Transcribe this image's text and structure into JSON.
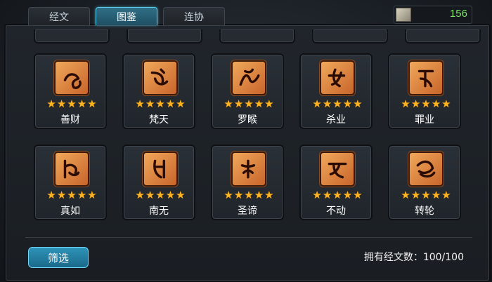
{
  "tabs": [
    {
      "label": "经文",
      "active": false
    },
    {
      "label": "图鉴",
      "active": true
    },
    {
      "label": "连协",
      "active": false
    }
  ],
  "currency": {
    "icon": "scroll-icon",
    "value": "156"
  },
  "cards": [
    {
      "name": "善财",
      "stars": 5,
      "glyph": "sanskrit-glyph-icon"
    },
    {
      "name": "梵天",
      "stars": 5,
      "glyph": "sanskrit-glyph-icon"
    },
    {
      "name": "罗睺",
      "stars": 5,
      "glyph": "sanskrit-glyph-icon"
    },
    {
      "name": "杀业",
      "stars": 5,
      "glyph": "sanskrit-glyph-icon"
    },
    {
      "name": "罪业",
      "stars": 5,
      "glyph": "sanskrit-glyph-icon"
    },
    {
      "name": "真如",
      "stars": 5,
      "glyph": "sanskrit-glyph-icon"
    },
    {
      "name": "南无",
      "stars": 5,
      "glyph": "sanskrit-glyph-icon"
    },
    {
      "name": "圣谛",
      "stars": 5,
      "glyph": "sanskrit-glyph-icon"
    },
    {
      "name": "不动",
      "stars": 5,
      "glyph": "sanskrit-glyph-icon"
    },
    {
      "name": "转轮",
      "stars": 5,
      "glyph": "sanskrit-glyph-icon"
    }
  ],
  "footer": {
    "filter_label": "筛选",
    "owned_text": "拥有经文数：100/100"
  },
  "colors": {
    "accent": "#5fd0f0",
    "star": "#ffb321",
    "currency": "#7fe36a"
  }
}
